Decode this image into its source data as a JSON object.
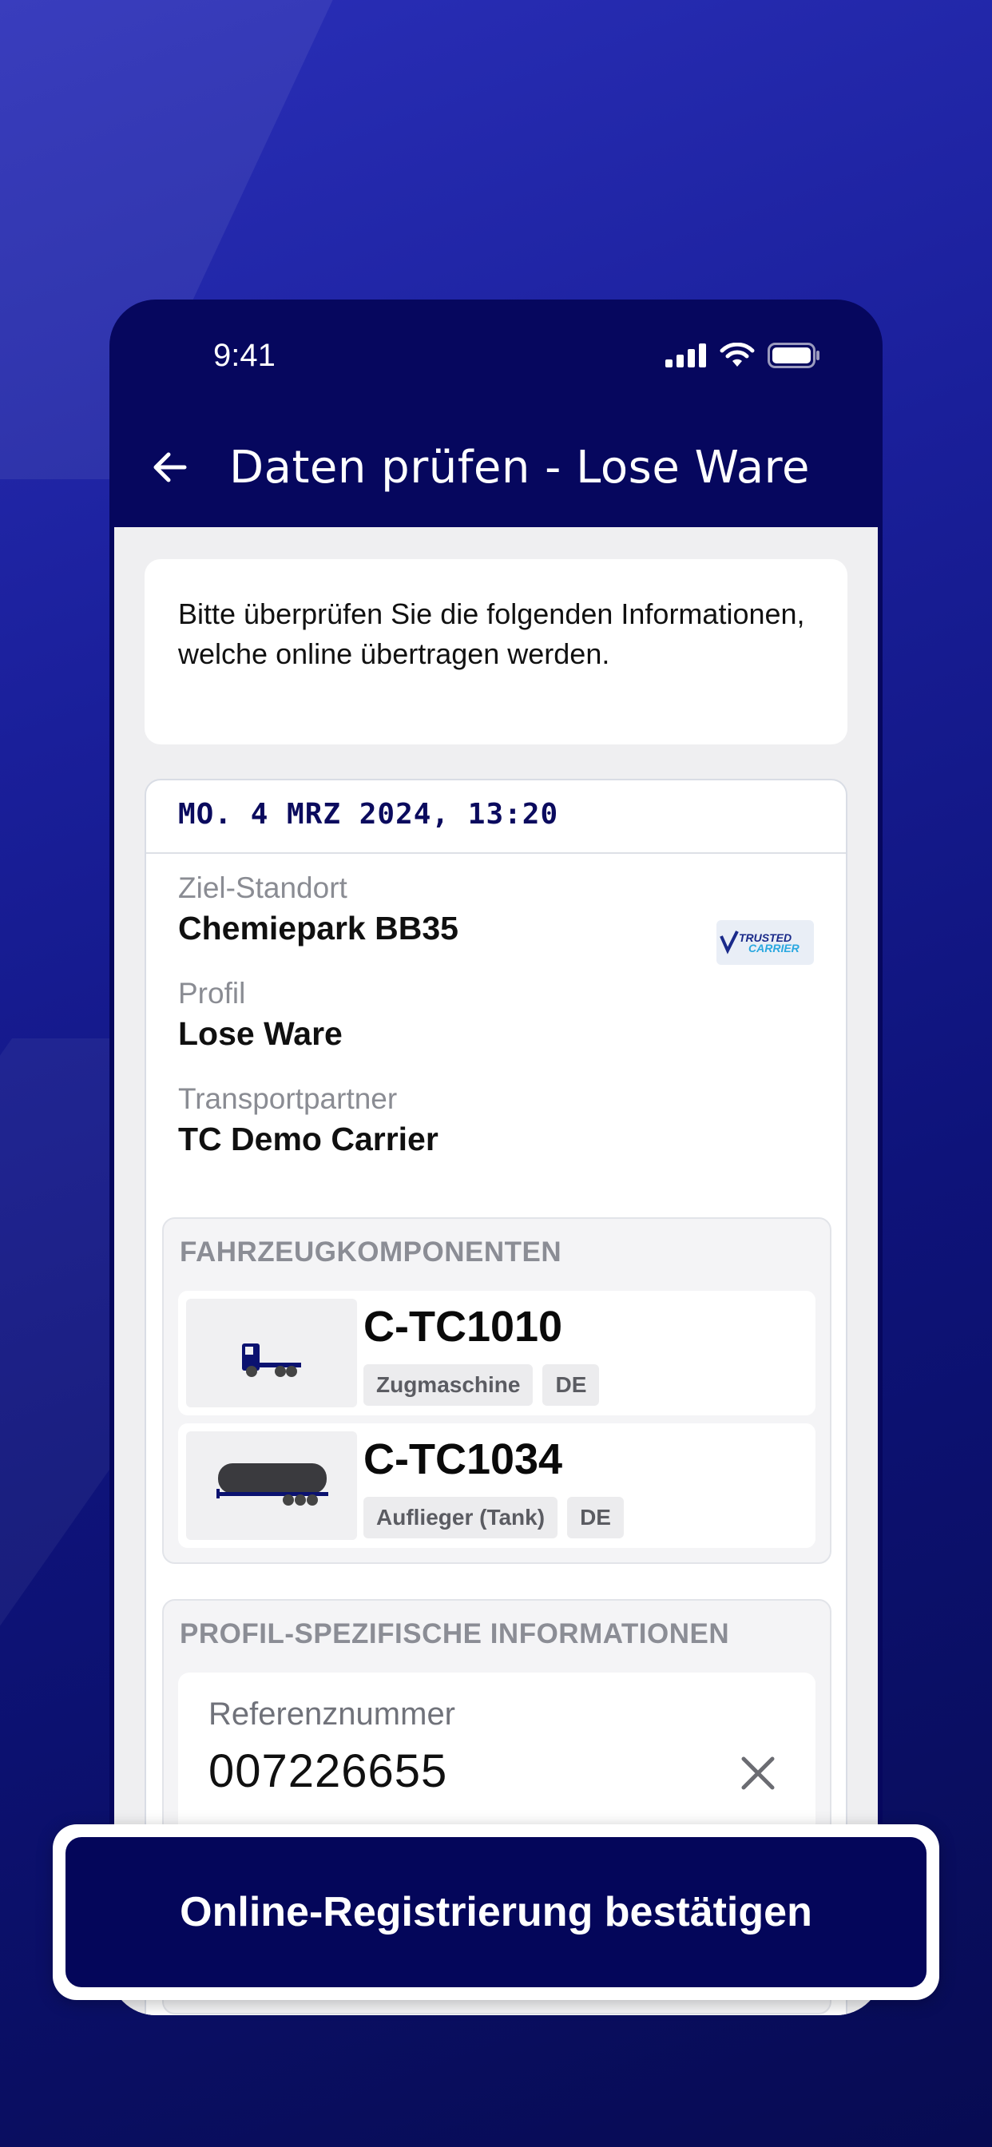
{
  "status_bar": {
    "time": "9:41"
  },
  "app_bar": {
    "title": "Daten prüfen - Lose Ware"
  },
  "info_text": "Bitte überprüfen Sie die folgenden Informationen, welche online übertragen werden.",
  "summary": {
    "date": "MO. 4 MRZ 2024, 13:20",
    "target_label": "Ziel-Standort",
    "target_value": "Chemiepark BB35",
    "profile_label": "Profil",
    "profile_value": "Lose Ware",
    "partner_label": "Transportpartner",
    "partner_value": "TC Demo Carrier",
    "logo_text_1": "TRUSTED",
    "logo_text_2": "CARRIER"
  },
  "vehicles": {
    "section_title": "FAHRZEUGKOMPONENTEN",
    "items": [
      {
        "plate": "C-TC1010",
        "type": "Zugmaschine",
        "country": "DE"
      },
      {
        "plate": "C-TC1034",
        "type": "Auflieger (Tank)",
        "country": "DE"
      }
    ]
  },
  "profile_info": {
    "section_title": "PROFIL-SPEZIFISCHE INFORMATIONEN",
    "ref_label": "Referenznummer",
    "ref_value": "007226655"
  },
  "cta": {
    "label": "Online-Registrierung bestätigen"
  },
  "colors": {
    "brand": "#06075e",
    "accent": "#04065a",
    "background": "#efeff1"
  }
}
